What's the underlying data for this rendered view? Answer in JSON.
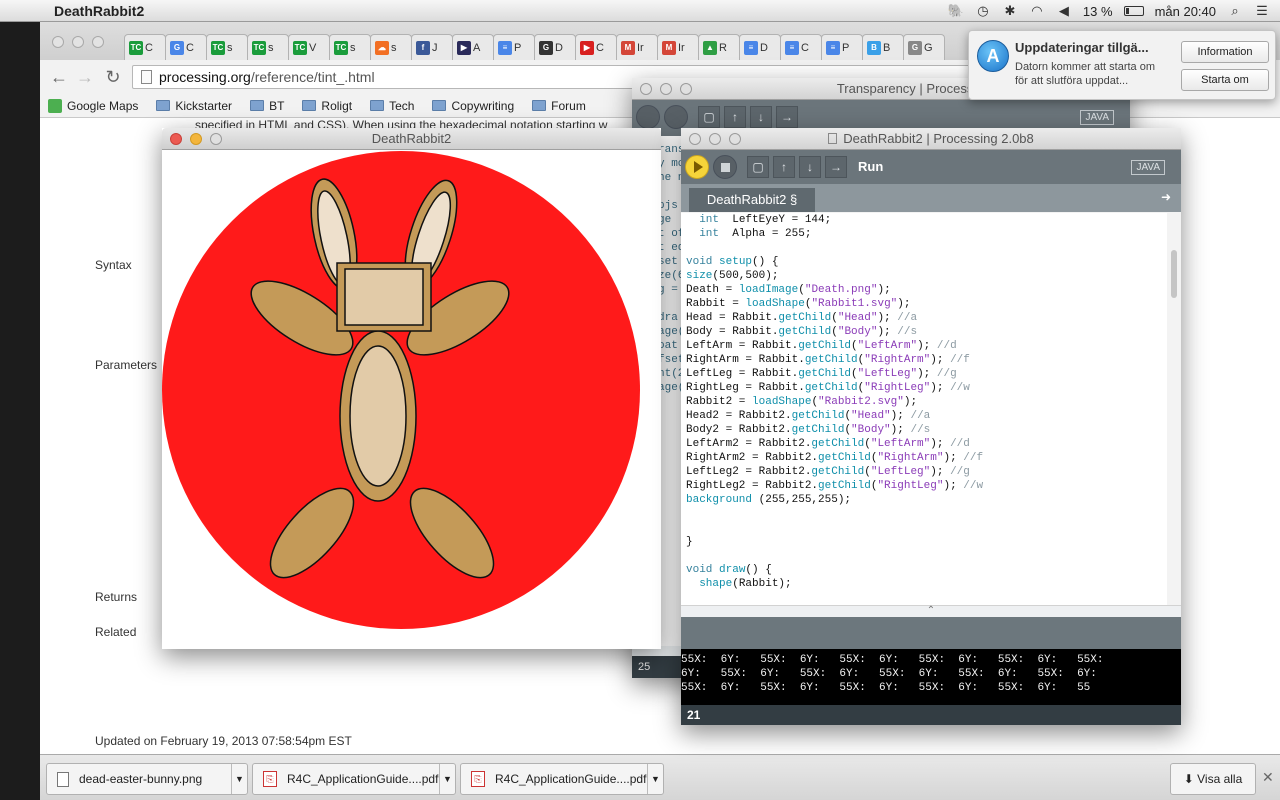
{
  "menubar": {
    "app_name": "DeathRabbit2",
    "battery": "13 %",
    "clock": "mån 20:40"
  },
  "browser": {
    "tabs": [
      {
        "fav": "TC",
        "color": "#1a9c3b",
        "label": "C"
      },
      {
        "fav": "G",
        "color": "#4a86e8",
        "label": "C"
      },
      {
        "fav": "TC",
        "color": "#1a9c3b",
        "label": "s"
      },
      {
        "fav": "TC",
        "color": "#1a9c3b",
        "label": "s"
      },
      {
        "fav": "TC",
        "color": "#1a9c3b",
        "label": "V"
      },
      {
        "fav": "TC",
        "color": "#1a9c3b",
        "label": "s"
      },
      {
        "fav": "☁",
        "color": "#f26f23",
        "label": "s"
      },
      {
        "fav": "f",
        "color": "#3b5998",
        "label": "J"
      },
      {
        "fav": "▶",
        "color": "#2a2a5a",
        "label": "A"
      },
      {
        "fav": "≡",
        "color": "#4a86e8",
        "label": "P"
      },
      {
        "fav": "G",
        "color": "#333333",
        "label": "D"
      },
      {
        "fav": "▶",
        "color": "#d8201f",
        "label": "C"
      },
      {
        "fav": "M",
        "color": "#d44638",
        "label": "Ir"
      },
      {
        "fav": "M",
        "color": "#d44638",
        "label": "Ir"
      },
      {
        "fav": "▲",
        "color": "#2f9e44",
        "label": "R"
      },
      {
        "fav": "≡",
        "color": "#4a86e8",
        "label": "D"
      },
      {
        "fav": "≡",
        "color": "#4a86e8",
        "label": "C"
      },
      {
        "fav": "≡",
        "color": "#4a86e8",
        "label": "P"
      },
      {
        "fav": "B",
        "color": "#3aa0e8",
        "label": "B"
      },
      {
        "fav": "G",
        "color": "#888888",
        "label": "G"
      }
    ],
    "url_host": "processing.org",
    "url_path": "/reference/tint_.html",
    "bookmarks": [
      "Google Maps",
      "Kickstarter",
      "BT",
      "Roligt",
      "Tech",
      "Copywriting",
      "Forum"
    ],
    "page": {
      "intro_text": "specified in HTML and CSS). When using the hexadecimal notation starting w",
      "labels": {
        "syntax": "Syntax",
        "parameters": "Parameters",
        "returns": "Returns",
        "related": "Related"
      },
      "updated": "Updated on February 19, 2013 07:58:54pm EST"
    },
    "downloads": [
      {
        "name": "dead-easter-bunny.png",
        "type": "png"
      },
      {
        "name": "R4C_ApplicationGuide....pdf",
        "type": "pdf"
      },
      {
        "name": "R4C_ApplicationGuide....pdf",
        "type": "pdf"
      }
    ],
    "show_all": "Visa alla"
  },
  "notification": {
    "title": "Uppdateringar tillgä...",
    "body": "Datorn kommer att starta om för att slutföra uppdat...",
    "btn_info": "Information",
    "btn_restart": "Starta om"
  },
  "transparency_window": {
    "title": "Transparency | Processing 2.",
    "code_fragments": [
      "ranspa",
      "y mo",
      "he n",
      "pjs",
      "ge",
      "t of",
      "t ed",
      "set",
      "ze(6",
      "g = ",
      "dra",
      "age(",
      "oat",
      "fset",
      "nt(2",
      "age("
    ],
    "java": "JAVA",
    "line": "25"
  },
  "sketch_window": {
    "title": "DeathRabbit2"
  },
  "editor_window": {
    "title": "DeathRabbit2 | Processing 2.0b8",
    "run_label": "Run",
    "java": "JAVA",
    "tab_label": "DeathRabbit2 §",
    "code_lines": [
      [
        [
          "kw",
          "  int"
        ],
        [
          "",
          "  LeftEyeY = 144;"
        ]
      ],
      [
        [
          "kw",
          "  int"
        ],
        [
          "",
          "  Alpha = 255;"
        ]
      ],
      [
        [
          "",
          ""
        ]
      ],
      [
        [
          "kw",
          "void"
        ],
        [
          "",
          " "
        ],
        [
          "fn",
          "setup"
        ],
        [
          "",
          "() {"
        ]
      ],
      [
        [
          "fn",
          "size"
        ],
        [
          "",
          "(500,500);"
        ]
      ],
      [
        [
          "",
          "Death = "
        ],
        [
          "fn",
          "loadImage"
        ],
        [
          "",
          "("
        ],
        [
          "st",
          "\"Death.png\""
        ],
        [
          "",
          ");"
        ]
      ],
      [
        [
          "",
          "Rabbit = "
        ],
        [
          "fn",
          "loadShape"
        ],
        [
          "",
          "("
        ],
        [
          "st",
          "\"Rabbit1.svg\""
        ],
        [
          "",
          ");"
        ]
      ],
      [
        [
          "",
          "Head = Rabbit."
        ],
        [
          "fn",
          "getChild"
        ],
        [
          "",
          "("
        ],
        [
          "st",
          "\"Head\""
        ],
        [
          "",
          "); "
        ],
        [
          "cm",
          "//a"
        ]
      ],
      [
        [
          "",
          "Body = Rabbit."
        ],
        [
          "fn",
          "getChild"
        ],
        [
          "",
          "("
        ],
        [
          "st",
          "\"Body\""
        ],
        [
          "",
          "); "
        ],
        [
          "cm",
          "//s"
        ]
      ],
      [
        [
          "",
          "LeftArm = Rabbit."
        ],
        [
          "fn",
          "getChild"
        ],
        [
          "",
          "("
        ],
        [
          "st",
          "\"LeftArm\""
        ],
        [
          "",
          "); "
        ],
        [
          "cm",
          "//d"
        ]
      ],
      [
        [
          "",
          "RightArm = Rabbit."
        ],
        [
          "fn",
          "getChild"
        ],
        [
          "",
          "("
        ],
        [
          "st",
          "\"RightArm\""
        ],
        [
          "",
          "); "
        ],
        [
          "cm",
          "//f"
        ]
      ],
      [
        [
          "",
          "LeftLeg = Rabbit."
        ],
        [
          "fn",
          "getChild"
        ],
        [
          "",
          "("
        ],
        [
          "st",
          "\"LeftLeg\""
        ],
        [
          "",
          "); "
        ],
        [
          "cm",
          "//g"
        ]
      ],
      [
        [
          "",
          "RightLeg = Rabbit."
        ],
        [
          "fn",
          "getChild"
        ],
        [
          "",
          "("
        ],
        [
          "st",
          "\"RightLeg\""
        ],
        [
          "",
          "); "
        ],
        [
          "cm",
          "//w"
        ]
      ],
      [
        [
          "",
          "Rabbit2 = "
        ],
        [
          "fn",
          "loadShape"
        ],
        [
          "",
          "("
        ],
        [
          "st",
          "\"Rabbit2.svg\""
        ],
        [
          "",
          ");"
        ]
      ],
      [
        [
          "",
          "Head2 = Rabbit2."
        ],
        [
          "fn",
          "getChild"
        ],
        [
          "",
          "("
        ],
        [
          "st",
          "\"Head\""
        ],
        [
          "",
          "); "
        ],
        [
          "cm",
          "//a"
        ]
      ],
      [
        [
          "",
          "Body2 = Rabbit2."
        ],
        [
          "fn",
          "getChild"
        ],
        [
          "",
          "("
        ],
        [
          "st",
          "\"Body\""
        ],
        [
          "",
          "); "
        ],
        [
          "cm",
          "//s"
        ]
      ],
      [
        [
          "",
          "LeftArm2 = Rabbit2."
        ],
        [
          "fn",
          "getChild"
        ],
        [
          "",
          "("
        ],
        [
          "st",
          "\"LeftArm\""
        ],
        [
          "",
          "); "
        ],
        [
          "cm",
          "//d"
        ]
      ],
      [
        [
          "",
          "RightArm2 = Rabbit2."
        ],
        [
          "fn",
          "getChild"
        ],
        [
          "",
          "("
        ],
        [
          "st",
          "\"RightArm\""
        ],
        [
          "",
          "); "
        ],
        [
          "cm",
          "//f"
        ]
      ],
      [
        [
          "",
          "LeftLeg2 = Rabbit2."
        ],
        [
          "fn",
          "getChild"
        ],
        [
          "",
          "("
        ],
        [
          "st",
          "\"LeftLeg\""
        ],
        [
          "",
          "); "
        ],
        [
          "cm",
          "//g"
        ]
      ],
      [
        [
          "",
          "RightLeg2 = Rabbit2."
        ],
        [
          "fn",
          "getChild"
        ],
        [
          "",
          "("
        ],
        [
          "st",
          "\"RightLeg\""
        ],
        [
          "",
          "); "
        ],
        [
          "cm",
          "//w"
        ]
      ],
      [
        [
          "fn",
          "background"
        ],
        [
          "",
          " (255,255,255);"
        ]
      ],
      [
        [
          "",
          ""
        ]
      ],
      [
        [
          "",
          ""
        ]
      ],
      [
        [
          "",
          "}"
        ]
      ],
      [
        [
          "",
          ""
        ]
      ],
      [
        [
          "kw",
          "void"
        ],
        [
          "",
          " "
        ],
        [
          "fn",
          "draw"
        ],
        [
          "",
          "() {"
        ]
      ],
      [
        [
          "",
          ""
        ],
        [
          "fn",
          "  shape"
        ],
        [
          "",
          "(Rabbit);"
        ]
      ]
    ],
    "console_lines": [
      "55X:  6Y:   55X:  6Y:   55X:  6Y:   55X:  6Y:   55X:  6Y:   55X:",
      "6Y:   55X:  6Y:   55X:  6Y:   55X:  6Y:   55X:  6Y:   55X:  6Y:",
      "55X:  6Y:   55X:  6Y:   55X:  6Y:   55X:  6Y:   55X:  6Y:   55"
    ],
    "line_number": "21"
  },
  "colors": {
    "sketch_red": "#ff1a1a",
    "rabbit_tan": "#c49a58",
    "rabbit_light": "#e2cba8",
    "processing_toolbar": "#6b757b"
  }
}
